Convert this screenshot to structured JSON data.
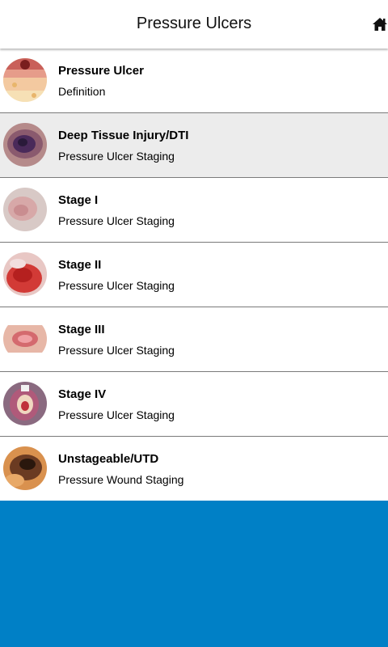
{
  "header": {
    "title": "Pressure Ulcers",
    "home_icon": "home-icon"
  },
  "items": [
    {
      "title": "Pressure Ulcer",
      "subtitle": "Definition",
      "thumb_icon": "skin-layers-thumbnail",
      "selected": false
    },
    {
      "title": "Deep Tissue Injury/DTI",
      "subtitle": "Pressure Ulcer Staging",
      "thumb_icon": "dti-wound-thumbnail",
      "selected": true
    },
    {
      "title": "Stage I",
      "subtitle": "Pressure Ulcer Staging",
      "thumb_icon": "stage-1-wound-thumbnail",
      "selected": false
    },
    {
      "title": "Stage II",
      "subtitle": "Pressure Ulcer Staging",
      "thumb_icon": "stage-2-wound-thumbnail",
      "selected": false
    },
    {
      "title": "Stage III",
      "subtitle": "Pressure Ulcer Staging",
      "thumb_icon": "stage-3-wound-thumbnail",
      "selected": false
    },
    {
      "title": "Stage IV",
      "subtitle": "Pressure Ulcer Staging",
      "thumb_icon": "stage-4-wound-thumbnail",
      "selected": false
    },
    {
      "title": "Unstageable/UTD",
      "subtitle": "Pressure Wound Staging",
      "thumb_icon": "unstageable-wound-thumbnail",
      "selected": false
    }
  ],
  "colors": {
    "background": "#0080c6",
    "selected_row": "#ececec",
    "divider": "#7a7a7a"
  }
}
